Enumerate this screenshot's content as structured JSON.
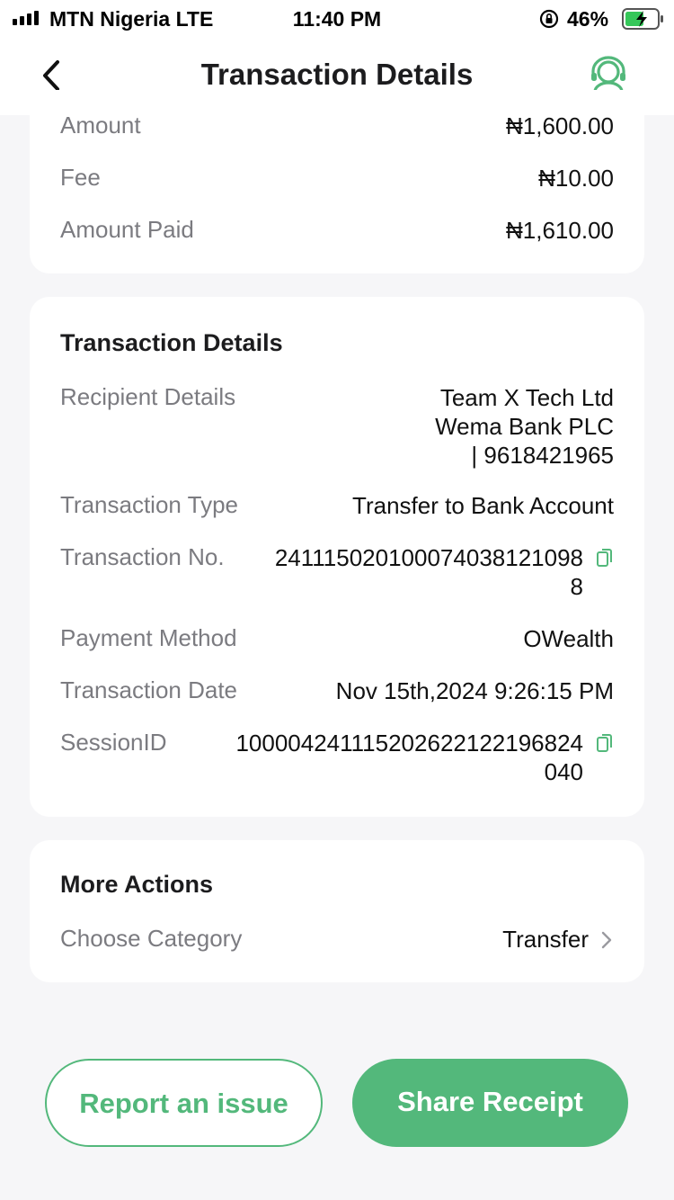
{
  "status_bar": {
    "carrier": "MTN Nigeria  LTE",
    "time": "11:40 PM",
    "battery_percent": "46%",
    "signal_bars": 4,
    "icons": [
      "signal-icon",
      "orientation-lock-icon",
      "battery-charging-icon"
    ]
  },
  "header": {
    "title": "Transaction Details",
    "back_icon": "chevron-left-icon",
    "support_icon": "support-headset-icon"
  },
  "summary": {
    "rows": [
      {
        "label": "Amount",
        "value": "₦1,600.00"
      },
      {
        "label": "Fee",
        "value": "₦10.00"
      },
      {
        "label": "Amount Paid",
        "value": "₦1,610.00"
      }
    ]
  },
  "details": {
    "title": "Transaction Details",
    "recipient_label": "Recipient Details",
    "recipient_line1": "Team X Tech Ltd",
    "recipient_line2": "Wema Bank PLC",
    "recipient_line3": "| 9618421965",
    "type_label": "Transaction Type",
    "type_value": "Transfer to Bank Account",
    "txn_no_label": "Transaction No.",
    "txn_no_line1": "241115020100074038121098",
    "txn_no_line2": "8",
    "method_label": "Payment Method",
    "method_value": "OWealth",
    "date_label": "Transaction Date",
    "date_value": "Nov 15th,2024 9:26:15 PM",
    "session_label": "SessionID",
    "session_line1": "100004241115202622122196824",
    "session_line2": "040"
  },
  "more_actions": {
    "title": "More Actions",
    "category_label": "Choose Category",
    "category_value": "Transfer"
  },
  "buttons": {
    "report": "Report an issue",
    "share": "Share Receipt"
  },
  "colors": {
    "accent": "#53b87b",
    "background": "#f6f6f8",
    "label": "#7b7b80"
  }
}
